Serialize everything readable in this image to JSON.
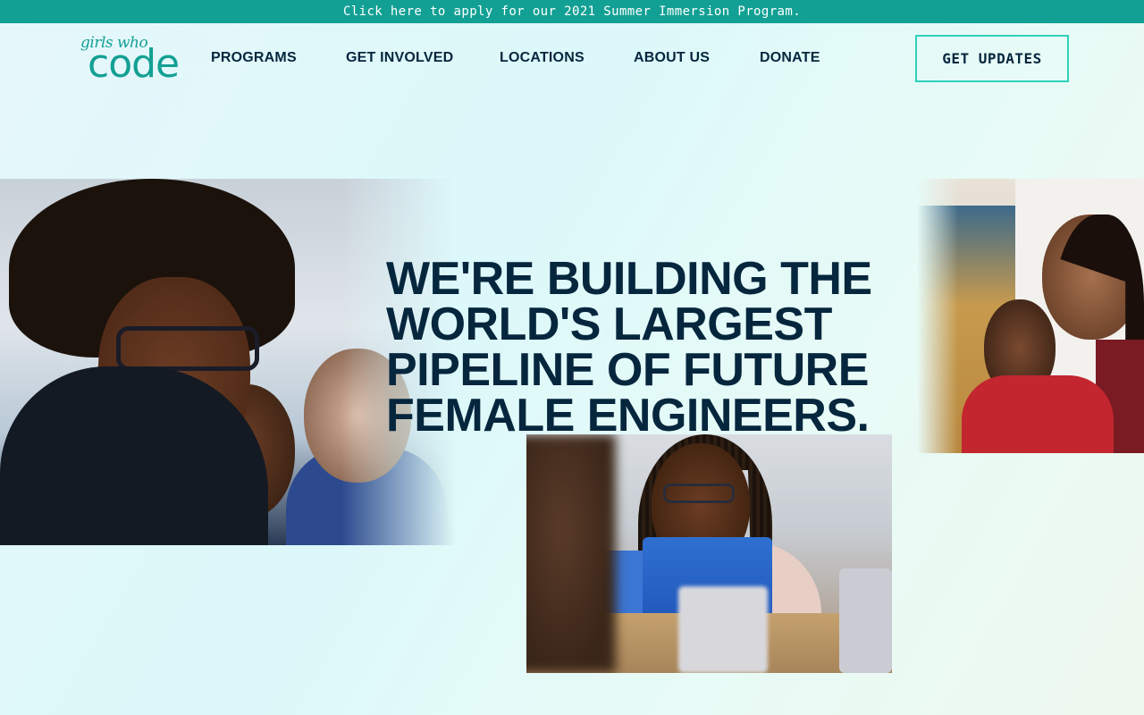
{
  "banner": {
    "text": "Click here to apply for our 2021 Summer Immersion Program."
  },
  "logo": {
    "script_text": "girls who",
    "code_text": "code"
  },
  "nav": {
    "items": [
      {
        "label": "PROGRAMS"
      },
      {
        "label": "GET INVOLVED"
      },
      {
        "label": "LOCATIONS"
      },
      {
        "label": "ABOUT US"
      },
      {
        "label": "DONATE"
      }
    ],
    "cta_label": "GET UPDATES"
  },
  "hero": {
    "lines": [
      "WE'RE BUILDING THE",
      "WORLD'S LARGEST",
      "PIPELINE OF FUTURE",
      "FEMALE ENGINEERS."
    ]
  },
  "colors": {
    "brand_teal": "#13a094",
    "accent_border": "#2fd1bc",
    "text_navy": "#05263d"
  }
}
